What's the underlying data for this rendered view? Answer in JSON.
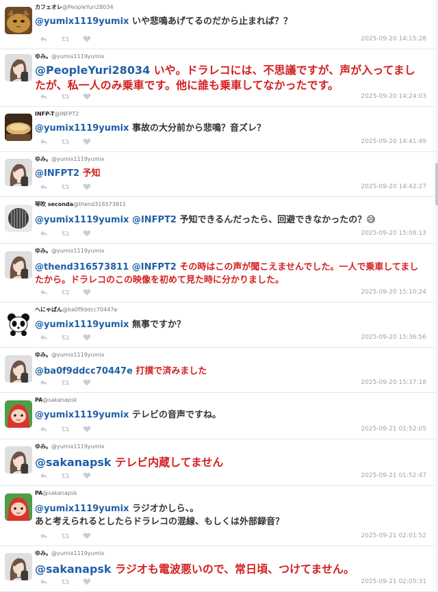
{
  "colors": {
    "mention": "#1f5fa6",
    "red_text": "#d31f1f",
    "timestamp": "#9aa3ad",
    "action_icon": "#c8ced4",
    "divider": "#e1e8ed"
  },
  "actions": [
    "reply-icon",
    "retweet-icon",
    "like-icon"
  ],
  "tweets": [
    {
      "avatar": "cat",
      "name": "カフェオレ",
      "handle": "@PeopleYuri28034",
      "segments": [
        {
          "t": "@yumix1119yumix",
          "c": "mention"
        },
        {
          "t": " いや悲鳴あげてるのだから止まれば？？",
          "c": "normal"
        }
      ],
      "time": "2025-09-20 14:15:28"
    },
    {
      "avatar": "yumi",
      "name": "ゆみ。",
      "handle": "@yumix1119yumix",
      "segments": [
        {
          "t": "@PeopleYuri28034",
          "c": "mention"
        },
        {
          "t": " いや。ドラレコには、不思議ですが、声が入ってましたが、私一人のみ乗車です。他に誰も乗車してなかったです。",
          "c": "red"
        }
      ],
      "time": "2025-09-20 14:24:03"
    },
    {
      "avatar": "food",
      "name": "INFP-T",
      "handle": "@INFPT2",
      "segments": [
        {
          "t": "@yumix1119yumix",
          "c": "mention"
        },
        {
          "t": " 事故の大分前から悲鳴？音ズレ？",
          "c": "normal"
        }
      ],
      "time": "2025-09-20 14:41:49"
    },
    {
      "avatar": "yumi",
      "name": "ゆみ。",
      "handle": "@yumix1119yumix",
      "segments": [
        {
          "t": "@INFPT2",
          "c": "mention"
        },
        {
          "t": " 予知",
          "c": "red"
        }
      ],
      "time": "2025-09-20 14:42:27"
    },
    {
      "avatar": "speaker",
      "name": "琴吹 seconda",
      "handle": "@thend316573811",
      "segments": [
        {
          "t": "@yumix1119yumix @INFPT2",
          "c": "mention"
        },
        {
          "t": " 予知できるんだったら、回避できなかったの？😅",
          "c": "normal"
        }
      ],
      "time": "2025-09-20 15:08:13"
    },
    {
      "avatar": "yumi",
      "name": "ゆみ。",
      "handle": "@yumix1119yumix",
      "segments": [
        {
          "t": "@thend316573811 @INFPT2",
          "c": "mention"
        },
        {
          "t": " その時はこの声が聞こえませんでした。一人で乗車してましたから。ドラレコのこの映像を初めて見た時に分かりました。",
          "c": "red"
        }
      ],
      "time": "2025-09-20 15:10:24"
    },
    {
      "avatar": "panda",
      "name": "へにゃぱん",
      "handle": "@ba0f9ddcc70447e",
      "segments": [
        {
          "t": "@yumix1119yumix",
          "c": "mention"
        },
        {
          "t": " 無事ですか？",
          "c": "normal"
        }
      ],
      "time": "2025-09-20 15:36:56"
    },
    {
      "avatar": "yumi",
      "name": "ゆみ。",
      "handle": "@yumix1119yumix",
      "segments": [
        {
          "t": "@ba0f9ddcc70447e",
          "c": "mention"
        },
        {
          "t": " 打撲で済みました",
          "c": "red"
        }
      ],
      "time": "2025-09-20 15:37:18"
    },
    {
      "avatar": "ponyo",
      "name": "PA",
      "handle": "@sakanapsk",
      "segments": [
        {
          "t": "@yumix1119yumix",
          "c": "mention"
        },
        {
          "t": " テレビの音声ですね。",
          "c": "normal"
        }
      ],
      "time": "2025-09-21 01:52:05"
    },
    {
      "avatar": "yumi",
      "name": "ゆみ。",
      "handle": "@yumix1119yumix",
      "segments": [
        {
          "t": "@sakanapsk",
          "c": "mention"
        },
        {
          "t": " テレビ内蔵してません",
          "c": "red"
        }
      ],
      "time": "2025-09-21 01:52:47"
    },
    {
      "avatar": "ponyo",
      "name": "PA",
      "handle": "@sakanapsk",
      "segments": [
        {
          "t": "@yumix1119yumix",
          "c": "mention"
        },
        {
          "t": " ラジオかしら、。\nあと考えられるとしたらドラレコの混線、もしくは外部録音？",
          "c": "normal"
        }
      ],
      "time": "2025-09-21 02:01:52"
    },
    {
      "avatar": "yumi",
      "name": "ゆみ。",
      "handle": "@yumix1119yumix",
      "segments": [
        {
          "t": "@sakanapsk",
          "c": "mention"
        },
        {
          "t": " ラジオも電波悪いので、常日頃、つけてません。",
          "c": "red"
        }
      ],
      "time": "2025-09-21 02:05:31"
    }
  ]
}
